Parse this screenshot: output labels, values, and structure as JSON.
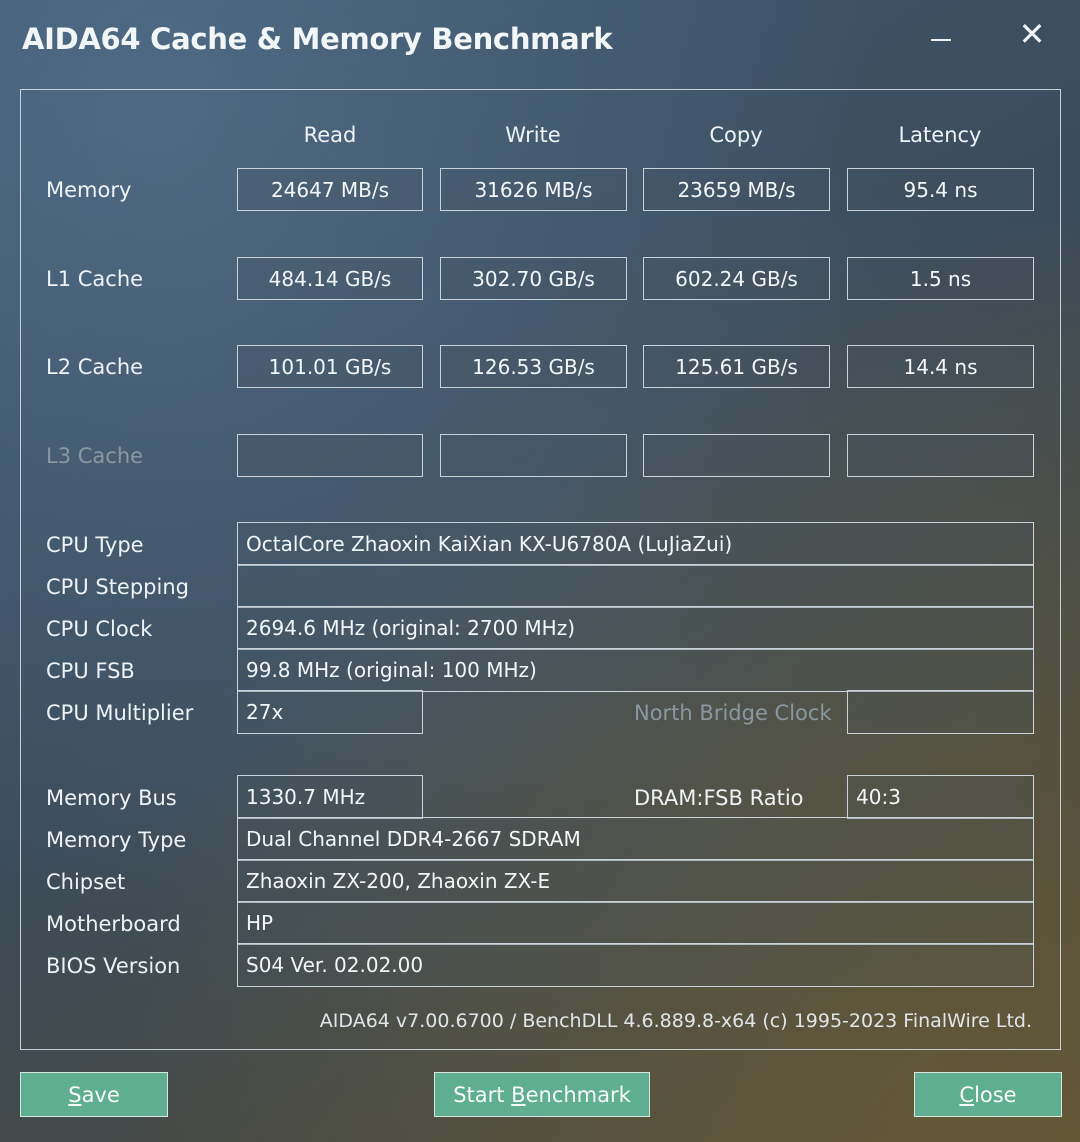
{
  "window": {
    "title": "AIDA64 Cache & Memory Benchmark",
    "minimize_glyph": "—",
    "close_glyph": "✕"
  },
  "columns": [
    "Read",
    "Write",
    "Copy",
    "Latency"
  ],
  "rows": [
    {
      "label": "Memory",
      "values": [
        "24647 MB/s",
        "31626 MB/s",
        "23659 MB/s",
        "95.4 ns"
      ],
      "disabled": false
    },
    {
      "label": "L1 Cache",
      "values": [
        "484.14 GB/s",
        "302.70 GB/s",
        "602.24 GB/s",
        "1.5 ns"
      ],
      "disabled": false
    },
    {
      "label": "L2 Cache",
      "values": [
        "101.01 GB/s",
        "126.53 GB/s",
        "125.61 GB/s",
        "14.4 ns"
      ],
      "disabled": false
    },
    {
      "label": "L3 Cache",
      "values": [
        "",
        "",
        "",
        ""
      ],
      "disabled": true
    }
  ],
  "cpu": {
    "type_label": "CPU Type",
    "type_value": "OctalCore Zhaoxin KaiXian KX-U6780A  (LuJiaZui)",
    "stepping_label": "CPU Stepping",
    "stepping_value": "",
    "clock_label": "CPU Clock",
    "clock_value": "2694.6 MHz  (original: 2700 MHz)",
    "fsb_label": "CPU FSB",
    "fsb_value": "99.8 MHz  (original: 100 MHz)",
    "multiplier_label": "CPU Multiplier",
    "multiplier_value": "27x",
    "nb_clock_label": "North Bridge Clock",
    "nb_clock_value": ""
  },
  "memory": {
    "bus_label": "Memory Bus",
    "bus_value": "1330.7 MHz",
    "ratio_label": "DRAM:FSB Ratio",
    "ratio_value": "40:3",
    "type_label": "Memory Type",
    "type_value": "Dual Channel DDR4-2667 SDRAM",
    "chipset_label": "Chipset",
    "chipset_value": "Zhaoxin ZX-200, Zhaoxin ZX-E",
    "motherboard_label": "Motherboard",
    "motherboard_value": "HP",
    "bios_label": "BIOS Version",
    "bios_value": "S04 Ver. 02.02.00"
  },
  "footer": "AIDA64 v7.00.6700 / BenchDLL 4.6.889.8-x64  (c) 1995-2023 FinalWire Ltd.",
  "buttons": {
    "save_pre": "",
    "save_key": "S",
    "save_post": "ave",
    "start_pre": "Start ",
    "start_key": "B",
    "start_post": "enchmark",
    "close_pre": "",
    "close_key": "C",
    "close_post": "lose"
  },
  "colors": {
    "button_bg": "#5fae92",
    "border": "#c9d2d8",
    "disabled_text": "#8a98a2"
  }
}
